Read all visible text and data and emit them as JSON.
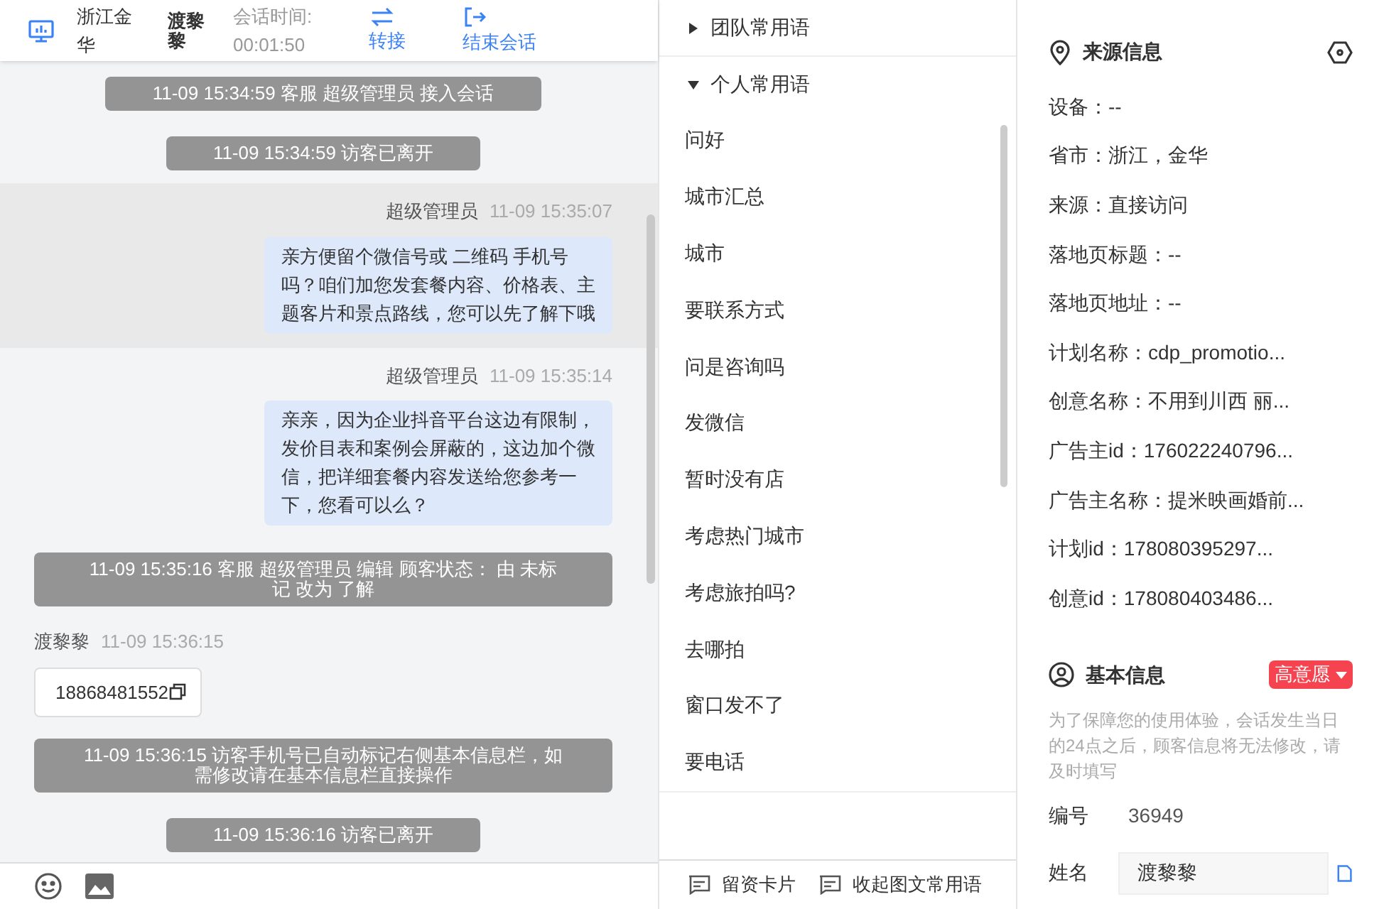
{
  "header": {
    "location": "浙江金华",
    "visitor": "渡黎黎",
    "duration_label": "会话时间:",
    "duration": "00:01:50",
    "actions": [
      {
        "kind": "transfer",
        "label": "转接"
      },
      {
        "kind": "end",
        "label": "结束会话"
      }
    ]
  },
  "messages": [
    {
      "kind": "system",
      "text": "11-09 15:34:59 客服 超级管理员 接入会话"
    },
    {
      "kind": "system",
      "text": "11-09 15:34:59 访客已离开"
    },
    {
      "kind": "agent",
      "name": "超级管理员",
      "time": "11-09 15:35:07",
      "text": "亲方便留个微信号或 二维码 手机号吗？咱们加您发套餐内容、价格表、主题客片和景点路线，您可以先了解下哦",
      "selected": true
    },
    {
      "kind": "agent",
      "name": "超级管理员",
      "time": "11-09 15:35:14",
      "text": "亲亲，因为企业抖音平台这边有限制，发价目表和案例会屏蔽的，这边加个微信，把详细套餐内容发送给您参考一下，您看可以么？",
      "selected": false
    },
    {
      "kind": "system",
      "text": "11-09 15:35:16 客服 超级管理员 编辑 顾客状态： 由 未标记 改为 了解"
    },
    {
      "kind": "visitor",
      "name": "渡黎黎",
      "time": "11-09 15:36:15",
      "text": "18868481552"
    },
    {
      "kind": "system",
      "text": "11-09 15:36:15 访客手机号已自动标记右侧基本信息栏，如需修改请在基本信息栏直接操作"
    },
    {
      "kind": "system",
      "text": "11-09 15:36:16 访客已离开"
    }
  ],
  "phrases": {
    "groups": [
      {
        "title": "团队常用语",
        "expanded": false
      },
      {
        "title": "个人常用语",
        "expanded": true,
        "items": [
          "问好",
          "城市汇总",
          "城市",
          "要联系方式",
          "问是咨询吗",
          "发微信",
          "暂时没有店",
          "考虑热门城市",
          "考虑旅拍吗?",
          "去哪拍",
          "窗口发不了",
          "要电话"
        ]
      }
    ],
    "footer": [
      "留资卡片",
      "收起图文常用语"
    ]
  },
  "source_info": {
    "title": "来源信息",
    "rows": [
      "设备：--",
      "省市：浙江，金华",
      "来源：直接访问",
      "落地页标题：--",
      "落地页地址：--",
      "计划名称：cdp_promotio...",
      "创意名称：不用到川西 丽...",
      "广告主id：176022240796...",
      "广告主名称：提米映画婚前...",
      "计划id：178080395297...",
      "创意id：178080403486..."
    ]
  },
  "basic_info": {
    "title": "基本信息",
    "intent": "高意愿",
    "notice": "为了保障您的使用体验，会话发生当日的24点之后，顾客信息将无法修改，请及时填写",
    "fields": [
      {
        "kind": "text",
        "label": "编号",
        "value": "36949"
      },
      {
        "kind": "input",
        "label": "姓名",
        "value": "渡黎黎"
      }
    ]
  }
}
